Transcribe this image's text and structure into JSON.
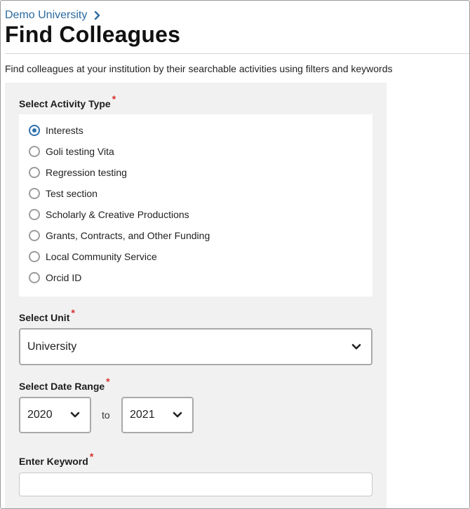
{
  "breadcrumb": {
    "link_label": "Demo University"
  },
  "page": {
    "title": "Find Colleagues",
    "intro": "Find colleagues at your institution by their searchable activities using filters and keywords"
  },
  "form": {
    "required_mark": "*",
    "activity_type": {
      "label": "Select Activity Type",
      "selected_index": 0,
      "options": [
        "Interests",
        "Goli testing Vita",
        "Regression testing",
        "Test section",
        "Scholarly & Creative Productions",
        "Grants, Contracts, and Other Funding",
        "Local Community Service",
        "Orcid ID"
      ]
    },
    "unit": {
      "label": "Select Unit",
      "value": "University"
    },
    "date_range": {
      "label": "Select Date Range",
      "from": "2020",
      "to_label": "to",
      "to": "2021"
    },
    "keyword": {
      "label": "Enter Keyword",
      "value": "",
      "placeholder": ""
    }
  },
  "colors": {
    "link": "#2b6a9e",
    "required": "#d9302c",
    "radio_selected": "#2f70b0",
    "panel_bg": "#f1f1f1"
  },
  "icons": {
    "breadcrumb_separator": "chevron-right-icon",
    "select_arrow": "chevron-down-icon"
  }
}
